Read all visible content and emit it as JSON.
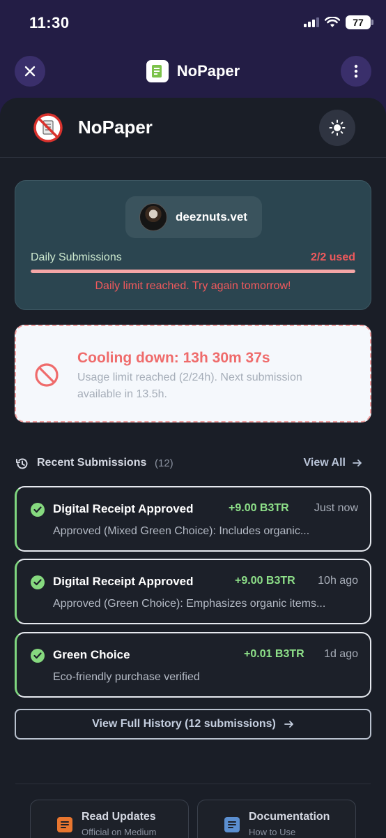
{
  "status_bar": {
    "time": "11:30",
    "battery": "77"
  },
  "topbar": {
    "app_name": "NoPaper"
  },
  "header": {
    "brand": "NoPaper"
  },
  "usage": {
    "username": "deeznuts.vet",
    "label": "Daily Submissions",
    "used_text": "2/2 used",
    "used_fraction": 1.0,
    "message": "Daily limit reached. Try again tomorrow!"
  },
  "cooldown": {
    "title": "Cooling down: 13h 30m 37s",
    "subtitle": "Usage limit reached (2/24h). Next submission available in 13.5h."
  },
  "recent": {
    "title": "Recent Submissions",
    "count": "(12)",
    "view_all": "View All",
    "items": [
      {
        "title": "Digital Receipt Approved",
        "reward": "+9.00 B3TR",
        "time": "Just now",
        "desc": "Approved (Mixed Green Choice): Includes organic..."
      },
      {
        "title": "Digital Receipt Approved",
        "reward": "+9.00 B3TR",
        "time": "10h ago",
        "desc": "Approved (Green Choice): Emphasizes organic items..."
      },
      {
        "title": "Green Choice",
        "reward": "+0.01 B3TR",
        "time": "1d ago",
        "desc": "Eco-friendly purchase verified"
      }
    ]
  },
  "history_button": "View Full History (12 submissions)",
  "links": [
    {
      "title": "Read Updates",
      "subtitle": "Official on Medium",
      "icon": "document-icon",
      "color": "#e8762f"
    },
    {
      "title": "Documentation",
      "subtitle": "How to Use",
      "icon": "document-icon",
      "color": "#5b8fd0"
    }
  ],
  "colors": {
    "accent_red": "#f0595c",
    "accent_green": "#8ee089",
    "purple_bar": "#231d45"
  }
}
